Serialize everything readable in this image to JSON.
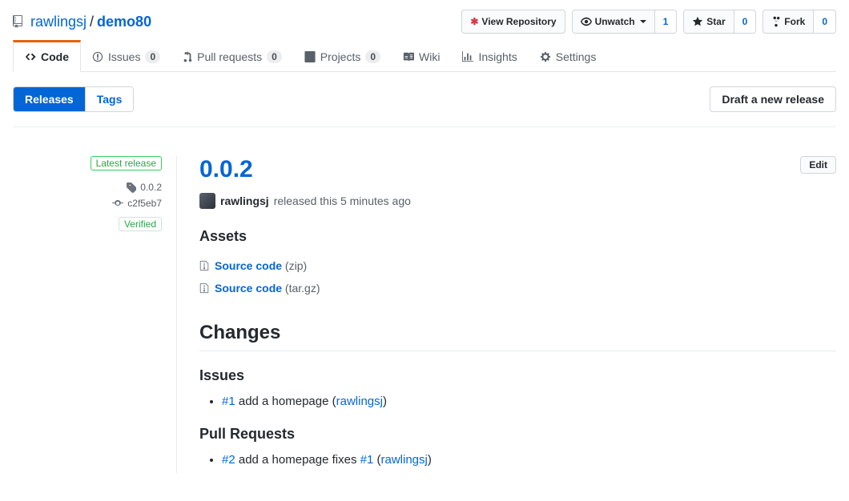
{
  "repo": {
    "owner": "rawlingsj",
    "name": "demo80"
  },
  "page_actions": {
    "view_repo": "View Repository",
    "unwatch": "Unwatch",
    "watch_count": "1",
    "star": "Star",
    "star_count": "0",
    "fork": "Fork",
    "fork_count": "0"
  },
  "nav": {
    "code": "Code",
    "issues": "Issues",
    "issues_count": "0",
    "pulls": "Pull requests",
    "pulls_count": "0",
    "projects": "Projects",
    "projects_count": "0",
    "wiki": "Wiki",
    "insights": "Insights",
    "settings": "Settings"
  },
  "subnav": {
    "releases": "Releases",
    "tags": "Tags",
    "draft": "Draft a new release"
  },
  "meta": {
    "latest": "Latest release",
    "tag": "0.0.2",
    "commit": "c2f5eb7",
    "verified": "Verified"
  },
  "release": {
    "title": "0.0.2",
    "edit": "Edit",
    "author": "rawlingsj",
    "released_text": "released this 5 minutes ago",
    "assets_heading": "Assets",
    "assets": [
      {
        "name": "Source code",
        "fmt": "(zip)"
      },
      {
        "name": "Source code",
        "fmt": "(tar.gz)"
      }
    ],
    "changes_heading": "Changes",
    "issues_heading": "Issues",
    "issues": [
      {
        "ref": "#1",
        "text": " add a homepage (",
        "user": "rawlingsj",
        "tail": ")"
      }
    ],
    "prs_heading": "Pull Requests",
    "prs": [
      {
        "ref": "#2",
        "text": " add a homepage fixes ",
        "link2": "#1",
        "mid": " (",
        "user": "rawlingsj",
        "tail": ")"
      }
    ]
  }
}
